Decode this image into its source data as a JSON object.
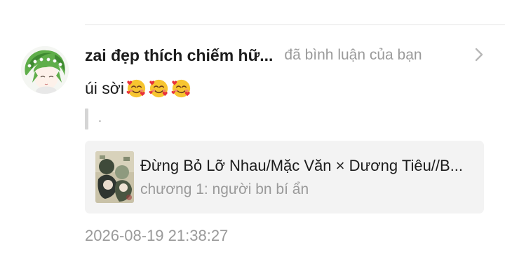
{
  "notification": {
    "username": "zai đẹp thích chiếm hữ...",
    "action_text": "đã bình luận của bạn",
    "avatar_icon": "anime-character-avatar",
    "chevron_icon": "chevron-right-icon",
    "comment": {
      "text": "úi sời",
      "emojis": [
        "smiling-face-with-hearts",
        "smiling-face-with-hearts",
        "smiling-face-with-hearts"
      ]
    },
    "quoted_text": ".",
    "story": {
      "title": "Đừng Bỏ Lỡ Nhau/Mặc Văn × Dương Tiêu//B...",
      "chapter": "chương 1: người bn bí ẩn",
      "cover_icon": "story-cover-image"
    },
    "timestamp": "2026-08-19 21:38:27"
  },
  "colors": {
    "primary_text": "#1c1c1c",
    "secondary_text": "#9a9a9a",
    "card_bg": "#f3f3f3",
    "quote_bar": "#d5d5d5",
    "divider": "#e4e4e4"
  }
}
